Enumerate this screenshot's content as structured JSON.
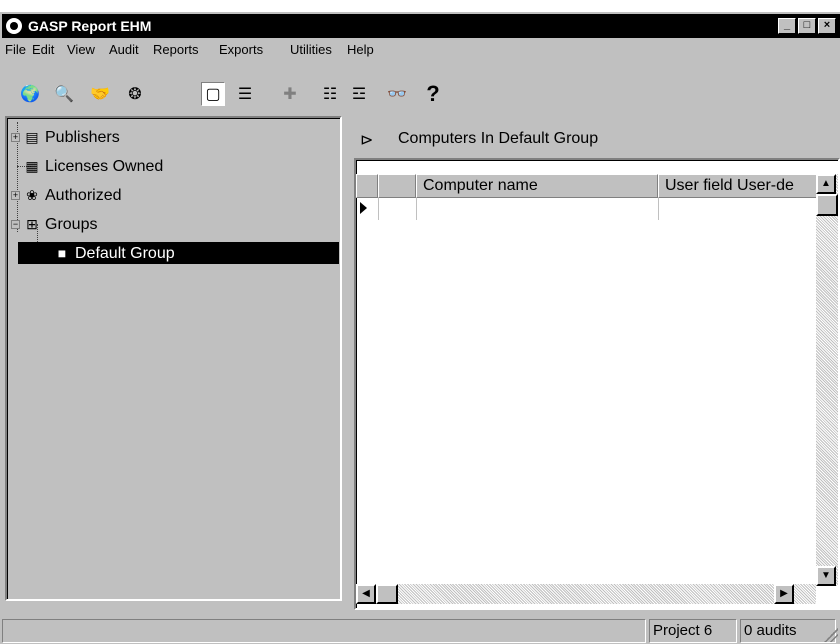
{
  "window": {
    "title": "GASP Report EHM"
  },
  "title_buttons": {
    "minimize": "_",
    "maximize": "□",
    "close": "×"
  },
  "menu": [
    {
      "label": "File"
    },
    {
      "label": "Edit"
    },
    {
      "label": "View"
    },
    {
      "label": "Audit"
    },
    {
      "label": "Reports"
    },
    {
      "label": "Exports"
    },
    {
      "label": "Utilities"
    },
    {
      "label": "Help"
    }
  ],
  "toolbar": [
    {
      "name": "globe-icon",
      "glyph": "🌍"
    },
    {
      "name": "magnify-icon",
      "glyph": "🔍"
    },
    {
      "name": "hand-icon",
      "glyph": "🤝"
    },
    {
      "name": "network-icon",
      "glyph": "❂"
    },
    {
      "name": "single-pane-icon",
      "glyph": "▢"
    },
    {
      "name": "split-pane-icon",
      "glyph": "☰"
    },
    {
      "name": "add-icon",
      "glyph": "✚"
    },
    {
      "name": "list-check-icon",
      "glyph": "☷"
    },
    {
      "name": "list-numbered-icon",
      "glyph": "☲"
    },
    {
      "name": "glasses-icon",
      "glyph": "👓"
    },
    {
      "name": "help-icon",
      "glyph": "?"
    }
  ],
  "tree": {
    "items": [
      {
        "label": "Publishers",
        "icon": "book-icon",
        "glyph": "▤",
        "expander": "+"
      },
      {
        "label": "Licenses Owned",
        "icon": "license-icon",
        "glyph": "▦"
      },
      {
        "label": "Authorized",
        "icon": "authorized-icon",
        "glyph": "❀",
        "expander": "+"
      },
      {
        "label": "Groups",
        "icon": "folders-icon",
        "glyph": "⊞",
        "expander": "−"
      },
      {
        "label": "Default Group",
        "icon": "folder-icon",
        "glyph": "■"
      }
    ]
  },
  "right_pane": {
    "header_title": "Computers In Default Group",
    "header_icon": "open-folder-icon",
    "header_glyph": "⊳",
    "columns": [
      {
        "label": ""
      },
      {
        "label": "Computer name"
      },
      {
        "label": "User field User-de"
      }
    ]
  },
  "status": {
    "main": "",
    "project": "Project 6",
    "audits": "0 audits"
  }
}
